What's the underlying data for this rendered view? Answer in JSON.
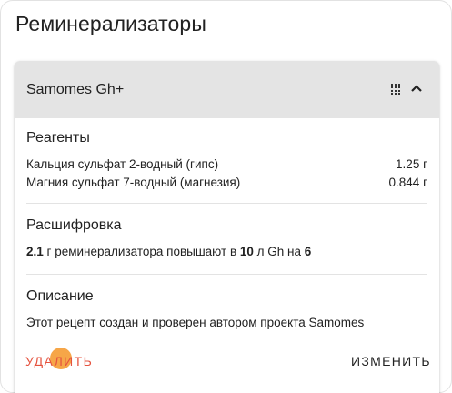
{
  "page": {
    "title": "Реминерализаторы"
  },
  "card": {
    "title": "Samomes Gh+",
    "icons": {
      "drag": "grid-dots-icon",
      "collapse": "chevron-up-icon"
    },
    "reagents": {
      "title": "Реагенты",
      "items": [
        {
          "name": "Кальция сульфат 2-водный (гипс)",
          "amount": "1.25 г"
        },
        {
          "name": "Магния сульфат 7-водный (магнезия)",
          "amount": "0.844 г"
        }
      ]
    },
    "decoding": {
      "title": "Расшифровка",
      "amount": "2.1",
      "text1": " г реминерализатора повышают в ",
      "volume": "10",
      "text2": " л Gh на ",
      "increase": "6"
    },
    "description": {
      "title": "Описание",
      "text": "Этот рецепт создан и проверен автором проекта Samomes"
    },
    "actions": {
      "delete": "УДАЛИТЬ",
      "edit": "ИЗМЕНИТЬ"
    }
  },
  "colors": {
    "delete": "#e5533f",
    "header_bg": "#e4e4e4",
    "touch": "#f5962a"
  }
}
